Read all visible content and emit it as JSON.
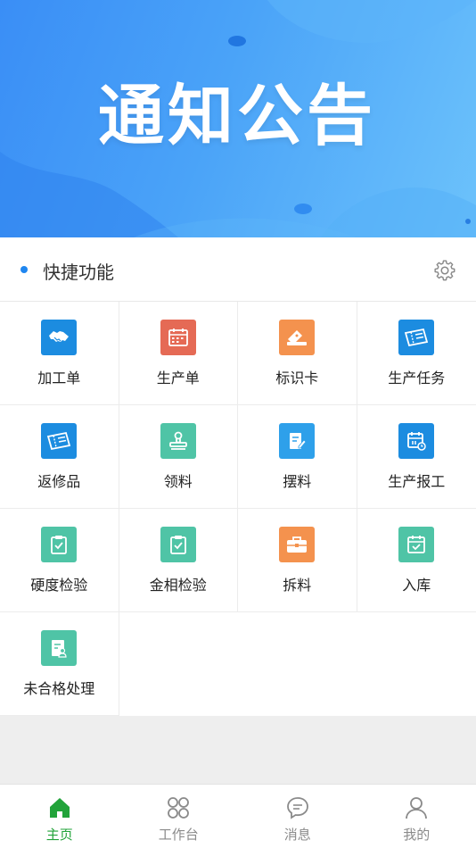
{
  "banner": {
    "title": "通知公告"
  },
  "quick": {
    "title": "快捷功能"
  },
  "grid_items": [
    {
      "label": "加工单",
      "icon": "handshake-icon",
      "color": "#1c8ce0"
    },
    {
      "label": "生产单",
      "icon": "calendar-icon",
      "color": "#e56a55"
    },
    {
      "label": "标识卡",
      "icon": "ticket-icon",
      "color": "#f4924e"
    },
    {
      "label": "生产任务",
      "icon": "ticket-icon",
      "color": "#1c8ce0"
    },
    {
      "label": "返修品",
      "icon": "ticket-icon",
      "color": "#1c8ce0"
    },
    {
      "label": "领料",
      "icon": "stamp-icon",
      "color": "#4fc4a6"
    },
    {
      "label": "摆料",
      "icon": "edit-doc-icon",
      "color": "#2ea0ea"
    },
    {
      "label": "生产报工",
      "icon": "calendar-icon",
      "color": "#1c8ce0"
    },
    {
      "label": "硬度检验",
      "icon": "clipboard-check-icon",
      "color": "#4fc4a6"
    },
    {
      "label": "金相检验",
      "icon": "clipboard-check-icon",
      "color": "#4fc4a6"
    },
    {
      "label": "拆料",
      "icon": "toolbox-icon",
      "color": "#f4924e"
    },
    {
      "label": "入库",
      "icon": "calendar-check-icon",
      "color": "#4fc4a6"
    },
    {
      "label": "未合格处理",
      "icon": "document-user-icon",
      "color": "#4fc4a6"
    }
  ],
  "tabs": [
    {
      "label": "主页",
      "icon": "home-icon",
      "active": true
    },
    {
      "label": "工作台",
      "icon": "workbench-icon",
      "active": false
    },
    {
      "label": "消息",
      "icon": "message-icon",
      "active": false
    },
    {
      "label": "我的",
      "icon": "user-icon",
      "active": false
    }
  ],
  "colors": {
    "accent": "#1f86f0",
    "tab_active": "#22a33a",
    "tab_inactive": "#8a8a8a"
  }
}
